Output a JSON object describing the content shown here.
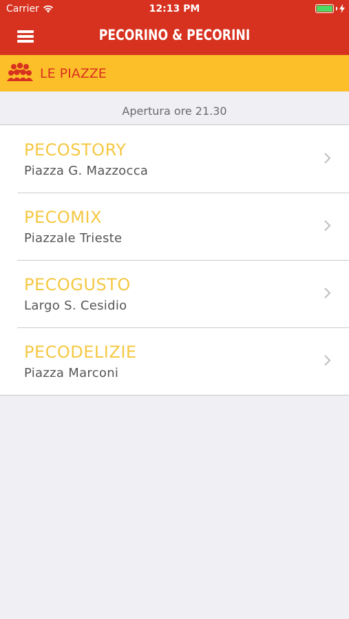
{
  "status_bar": {
    "carrier": "Carrier",
    "time": "12:13 PM",
    "battery_level": 1.0
  },
  "nav": {
    "title": "PECORINO & PECORINI",
    "menu_icon": "hamburger-menu-icon"
  },
  "section": {
    "title": "LE PIAZZE",
    "icon": "people-group-icon"
  },
  "subheader": {
    "text": "Apertura ore 21.30"
  },
  "places": [
    {
      "title": "PECOSTORY",
      "subtitle": "Piazza G. Mazzocca"
    },
    {
      "title": "PECOMIX",
      "subtitle": "Piazzale Trieste"
    },
    {
      "title": "PECOGUSTO",
      "subtitle": "Largo S. Cesidio"
    },
    {
      "title": "PECODELIZIE",
      "subtitle": "Piazza Marconi"
    }
  ],
  "colors": {
    "primary_red": "#d7311f",
    "accent_yellow": "#fdbf29",
    "title_yellow": "#f5c842",
    "background": "#efeff4"
  }
}
